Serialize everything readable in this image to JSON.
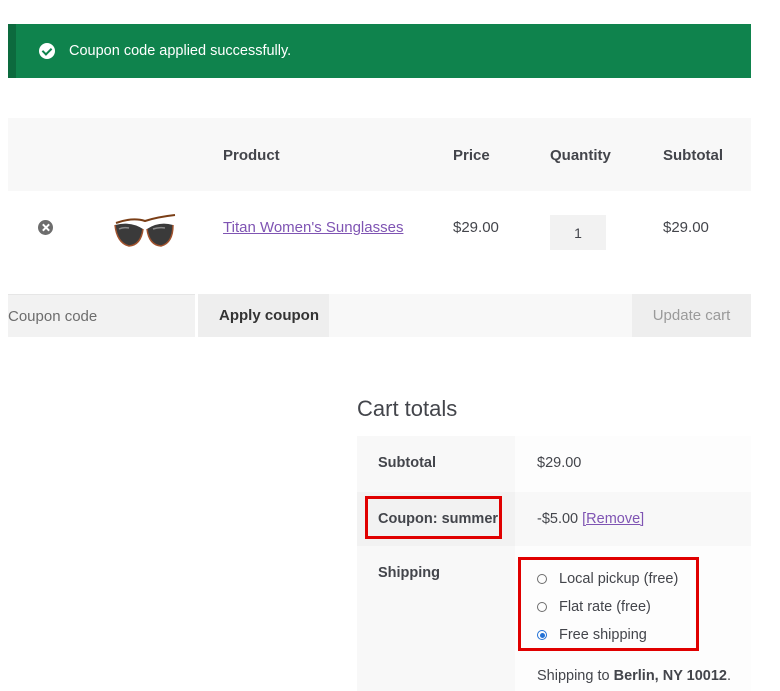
{
  "notice": {
    "message": "Coupon code applied successfully."
  },
  "cart_table": {
    "headers": {
      "product": "Product",
      "price": "Price",
      "quantity": "Quantity",
      "subtotal": "Subtotal"
    },
    "items": [
      {
        "product": "Titan Women's Sunglasses",
        "price": "$29.00",
        "quantity": "1",
        "subtotal": "$29.00"
      }
    ]
  },
  "actions": {
    "coupon_placeholder": "Coupon code",
    "apply_label": "Apply coupon",
    "update_label": "Update cart"
  },
  "cart_totals": {
    "title": "Cart totals",
    "subtotal_label": "Subtotal",
    "subtotal_value": "$29.00",
    "coupon_label": "Coupon: summer",
    "coupon_value": "-$5.00",
    "coupon_remove": "[Remove]",
    "shipping_label": "Shipping",
    "shipping_options": [
      {
        "label": "Local pickup (free)",
        "selected": false
      },
      {
        "label": "Flat rate (free)",
        "selected": false
      },
      {
        "label": "Free shipping",
        "selected": true
      }
    ],
    "shipping_to_prefix": "Shipping to ",
    "shipping_to_place": "Berlin, NY 10012",
    "shipping_to_suffix": "."
  },
  "colors": {
    "notice_bg": "#0f834d",
    "link": "#7f54b3",
    "highlight": "#e00000",
    "radio_selected": "#2271d6"
  },
  "icons": {
    "notice": "check-circle-icon",
    "remove": "remove-item-icon"
  }
}
